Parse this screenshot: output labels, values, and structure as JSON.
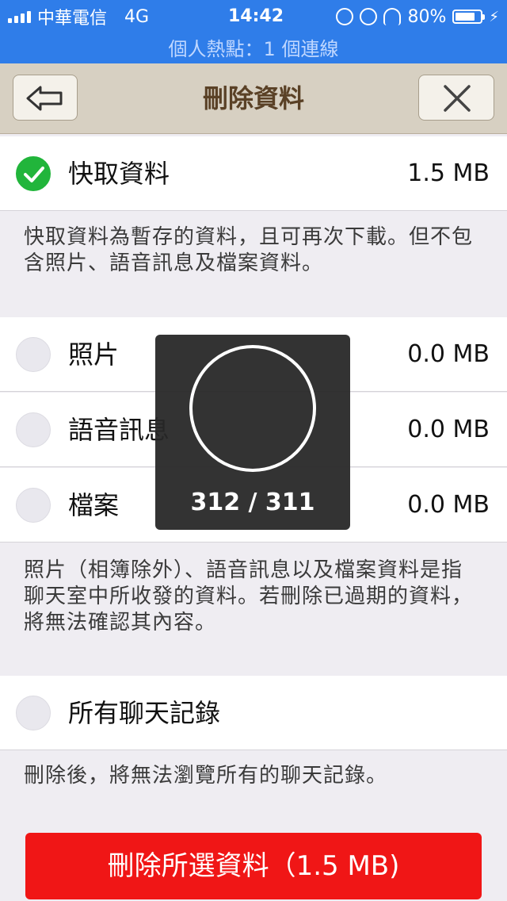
{
  "status_bar": {
    "carrier": "中華電信",
    "network": "4G",
    "time": "14:42",
    "battery": "80%",
    "hotspot": "個人熱點：1 個連線"
  },
  "nav": {
    "title": "刪除資料",
    "back_icon": "back-arrow-icon",
    "close_icon": "close-icon"
  },
  "items": [
    {
      "label": "快取資料",
      "size": "1.5 MB",
      "checked": true
    },
    {
      "label": "照片",
      "size": "0.0 MB",
      "checked": false
    },
    {
      "label": "語音訊息",
      "size": "0.0 MB",
      "checked": false
    },
    {
      "label": "檔案",
      "size": "0.0 MB",
      "checked": false
    },
    {
      "label": "所有聊天記錄",
      "checked": false
    }
  ],
  "descriptions": {
    "cache": "快取資料為暫存的資料，且可再次下載。但不包含照片、語音訊息及檔案資料。",
    "media": "照片（相簿除外）、語音訊息以及檔案資料是指聊天室中所收發的資料。若刪除已過期的資料，將無法確認其內容。",
    "chat": "刪除後，將無法瀏覽所有的聊天記錄。"
  },
  "delete_button": "刪除所選資料（1.5 MB)",
  "progress": {
    "text": "312 / 311"
  },
  "colors": {
    "status_bar": "#2f7de9",
    "nav_bar": "#d7d0c2",
    "check": "#21b53b",
    "delete": "#f01616"
  }
}
